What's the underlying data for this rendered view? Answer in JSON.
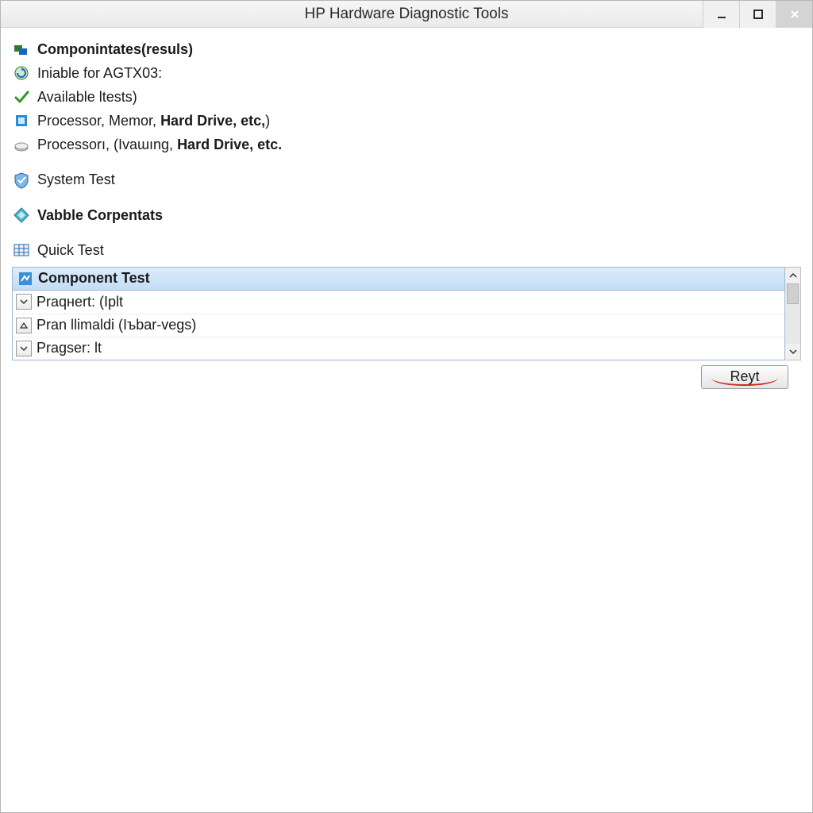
{
  "window": {
    "title": "HP Hardware Diagnostic Tools"
  },
  "header": {
    "components_results": "Componintates(resuls)",
    "iniable_for": "Iniable for AGTX03:",
    "available_tests": "Available ltests)",
    "proc_line1_prefix": "Processor, Memor, ",
    "proc_line1_bold": "Hard Drive, etc,",
    "proc_line1_suffix": ")",
    "proc_line2_prefix": "Processorı, (Ivaɯıng, ",
    "proc_line2_bold": "Hard Drive, etc.",
    "proc_line2_suffix": ""
  },
  "sections": {
    "system_test": "System Test",
    "vabble_corpentats": "Vabble Corpentats",
    "quick_test": "Quick Test"
  },
  "panel": {
    "header": "Component Test",
    "rows": [
      {
        "disclose": "chevron-down",
        "text": "Praqнert: (Iplt"
      },
      {
        "disclose": "triangle",
        "text": "Pran llimaldi (Iъbar-vegs)"
      },
      {
        "disclose": "chevron-down",
        "text": "Pragser: lt"
      }
    ]
  },
  "footer": {
    "reyt": "Reyt"
  },
  "colors": {
    "header_grad_top": "#dcecfb",
    "header_grad_bottom": "#c3ddf5",
    "panel_border": "#9fb7cf",
    "accent_red": "#cc2a1f"
  }
}
